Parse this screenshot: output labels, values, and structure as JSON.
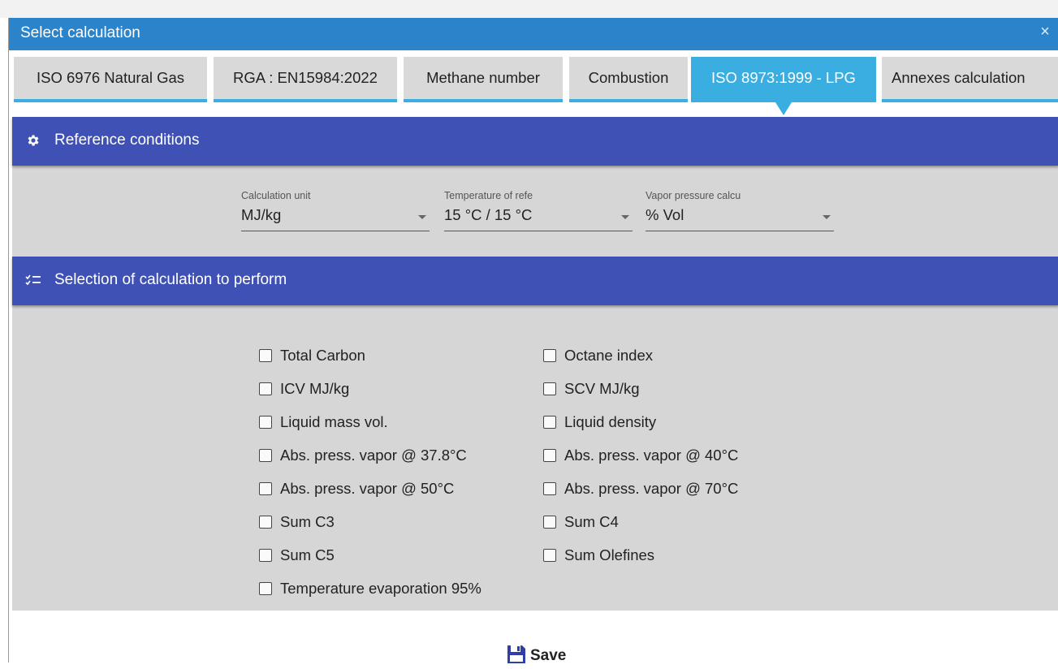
{
  "window": {
    "title": "Select calculation",
    "close_glyph": "×"
  },
  "tabs": [
    {
      "label": "ISO 6976 Natural Gas",
      "active": false
    },
    {
      "label": "RGA : EN15984:2022",
      "active": false
    },
    {
      "label": "Methane number",
      "active": false
    },
    {
      "label": "Combustion",
      "active": false
    },
    {
      "label": "ISO 8973:1999 - LPG",
      "active": true
    },
    {
      "label": "Annexes calculation",
      "active": false
    }
  ],
  "reference_conditions": {
    "title": "Reference conditions",
    "icon": "gear-icon",
    "fields": [
      {
        "label": "Calculation unit",
        "value": "MJ/kg"
      },
      {
        "label": "Temperature of refe",
        "value": "15 °C / 15 °C"
      },
      {
        "label": "Vapor pressure calcu",
        "value": "% Vol"
      }
    ]
  },
  "selection": {
    "title": "Selection of calculation to perform",
    "icon": "checklist-icon",
    "left_column": [
      {
        "label": "Total Carbon",
        "checked": false
      },
      {
        "label": "ICV MJ/kg",
        "checked": false
      },
      {
        "label": "Liquid mass vol.",
        "checked": false
      },
      {
        "label": "Abs. press. vapor @ 37.8°C",
        "checked": false
      },
      {
        "label": "Abs. press. vapor @ 50°C",
        "checked": false
      },
      {
        "label": "Sum C3",
        "checked": false
      },
      {
        "label": "Sum C5",
        "checked": false
      },
      {
        "label": "Temperature evaporation 95%",
        "checked": false
      }
    ],
    "right_column": [
      {
        "label": "Octane index",
        "checked": false
      },
      {
        "label": "SCV MJ/kg",
        "checked": false
      },
      {
        "label": "Liquid density",
        "checked": false
      },
      {
        "label": "Abs. press. vapor @ 40°C",
        "checked": false
      },
      {
        "label": "Abs. press. vapor @ 70°C",
        "checked": false
      },
      {
        "label": "Sum C4",
        "checked": false
      },
      {
        "label": "Sum Olefines",
        "checked": false
      }
    ]
  },
  "footer": {
    "save_label": "Save",
    "save_icon": "floppy-disk-icon"
  },
  "colors": {
    "title_bar": "#2b84c9",
    "tab_active": "#3aaee0",
    "section_header": "#3f51b5",
    "panel_bg": "#d6d6d6",
    "save_icon": "#2f3fa8"
  }
}
